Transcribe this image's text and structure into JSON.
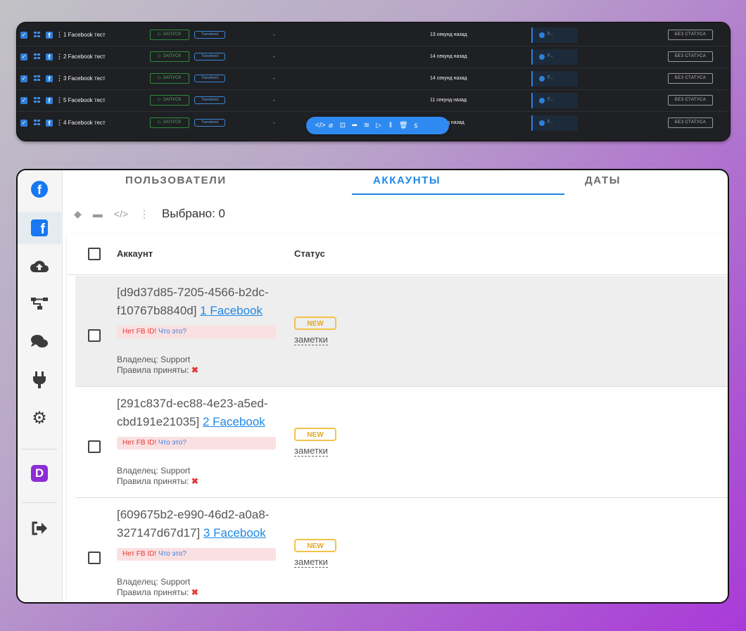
{
  "dark_table": {
    "launch_label": "▷ ЗАПУСК",
    "transferred_label": "Transfered",
    "status_label": "БЕЗ СТАТУСА",
    "rows": [
      {
        "name": "1 Facebook тест",
        "dash": "-",
        "time": "13 секунд назад",
        "fb": "F..."
      },
      {
        "name": "2 Facebook тест",
        "dash": "-",
        "time": "14 секунд назад",
        "fb": "F..."
      },
      {
        "name": "3 Facebook тест",
        "dash": "-",
        "time": "14 секунд назад",
        "fb": "F..."
      },
      {
        "name": "5 Facebook тест",
        "dash": "-",
        "time": "11 секунд назад",
        "fb": "F..."
      },
      {
        "name": "4 Facebook тест",
        "dash": "-",
        "time": "нд назад",
        "fb": "F..."
      }
    ]
  },
  "bulk_toolbar": {
    "icons": [
      "code-icon",
      "tag-icon",
      "archive-icon",
      "share-icon",
      "wifi-icon",
      "play-icon",
      "pause-icon",
      "trash-icon"
    ],
    "count": "5"
  },
  "sidebar": {
    "items": [
      "facebook-circle",
      "facebook-square",
      "cloud-upload",
      "sitemap",
      "comments",
      "plug",
      "gear",
      "dolphin-app",
      "sign-out"
    ]
  },
  "tabs": {
    "users": "ПОЛЬЗОВАТЕЛИ",
    "accounts": "АККАУНТЫ",
    "dates": "ДАТЫ"
  },
  "actions": {
    "selected": "Выбрано: 0"
  },
  "table": {
    "col_account": "Аккаунт",
    "col_status": "Статус",
    "rows": [
      {
        "id": "[d9d37d85-7205-4566-b2dc-f10767b8840d]",
        "link": "1 Facebook",
        "no_fb": "Нет FB ID!",
        "what": "Что это?",
        "owner": "Владелец: Support",
        "rules": "Правила приняты:",
        "badge": "NEW",
        "notes": "заметки"
      },
      {
        "id": "[291c837d-ec88-4e23-a5ed-cbd191e21035]",
        "link": "2 Facebook",
        "no_fb": "Нет FB ID!",
        "what": "Что это?",
        "owner": "Владелец: Support",
        "rules": "Правила приняты:",
        "badge": "NEW",
        "notes": "заметки"
      },
      {
        "id": "[609675b2-e990-46d2-a0a8-327147d67d17]",
        "link": "3 Facebook",
        "no_fb": "Нет FB ID!",
        "what": "Что это?",
        "owner": "Владелец: Support",
        "rules": "Правила приняты:",
        "badge": "NEW",
        "notes": "заметки"
      }
    ]
  },
  "colors": {
    "accent": "#1e88e5",
    "facebook": "#1877f2",
    "launch_green": "#4fb060",
    "badge_yellow": "#f3c24a",
    "error_red": "#e53935"
  }
}
